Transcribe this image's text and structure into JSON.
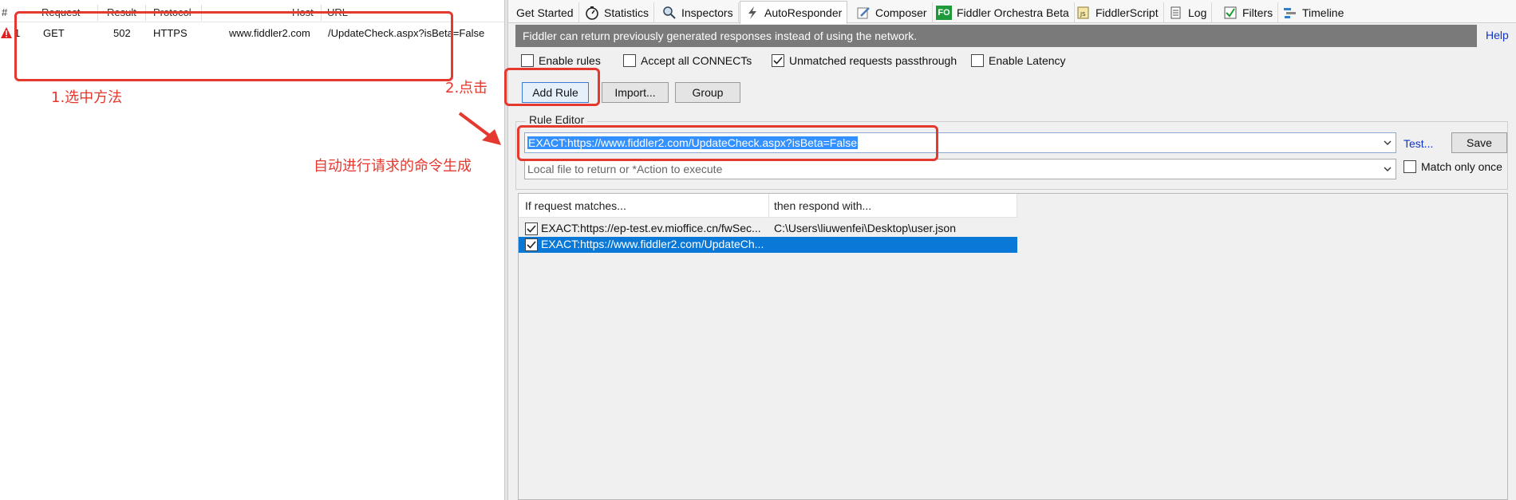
{
  "sessions": {
    "headers": [
      "#",
      "Request",
      "Result",
      "Protocol",
      "Host",
      "URL"
    ],
    "rows": [
      {
        "num": "1",
        "method": "GET",
        "result": "502",
        "protocol": "HTTPS",
        "host": "www.fiddler2.com",
        "url": "/UpdateCheck.aspx?isBeta=False"
      }
    ]
  },
  "tabs": [
    {
      "label": "Get Started",
      "icon": "none"
    },
    {
      "label": "Statistics",
      "icon": "timer-icon"
    },
    {
      "label": "Inspectors",
      "icon": "inspect-icon"
    },
    {
      "label": "AutoResponder",
      "icon": "lightning-icon"
    },
    {
      "label": "Composer",
      "icon": "pencil-icon"
    },
    {
      "label": "Fiddler Orchestra Beta",
      "icon": "fo-icon"
    },
    {
      "label": "FiddlerScript",
      "icon": "script-icon"
    },
    {
      "label": "Log",
      "icon": "log-icon"
    },
    {
      "label": "Filters",
      "icon": "check-icon"
    },
    {
      "label": "Timeline",
      "icon": "timeline-icon"
    }
  ],
  "autoresponder": {
    "info_text": "Fiddler can return previously generated responses instead of using the network.",
    "help_label": "Help",
    "options": {
      "enable_rules": {
        "label": "Enable rules",
        "checked": false
      },
      "accept_connects": {
        "label": "Accept all CONNECTs",
        "checked": false
      },
      "unmatched_passthrough": {
        "label": "Unmatched requests passthrough",
        "checked": true
      },
      "enable_latency": {
        "label": "Enable Latency",
        "checked": false
      }
    },
    "buttons": {
      "add_rule": "Add Rule",
      "import": "Import...",
      "group": "Group"
    },
    "rule_editor": {
      "label": "Rule Editor",
      "match_value": "EXACT:https://www.fiddler2.com/UpdateCheck.aspx?isBeta=False",
      "action_placeholder": "Local file to return or *Action to execute",
      "test_label": "Test...",
      "save_label": "Save",
      "match_only_once": "Match only once"
    },
    "rules_table": {
      "headers": [
        "If request matches...",
        "then respond with..."
      ],
      "rows": [
        {
          "match": "EXACT:https://ep-test.ev.mioffice.cn/fwSec...",
          "respond": "C:\\Users\\liuwenfei\\Desktop\\user.json",
          "checked": true,
          "selected": false
        },
        {
          "match": "EXACT:https://www.fiddler2.com/UpdateCh...",
          "respond": "",
          "checked": true,
          "selected": true
        }
      ]
    }
  },
  "annotations": {
    "step1": "1.选中方法",
    "step2": "2.点击",
    "auto_generated": "自动进行请求的命令生成"
  },
  "colors": {
    "annotation": "#e5382e",
    "selection": "#0a78d7",
    "info_bar": "#7a7a7a",
    "link": "#1034cc"
  }
}
